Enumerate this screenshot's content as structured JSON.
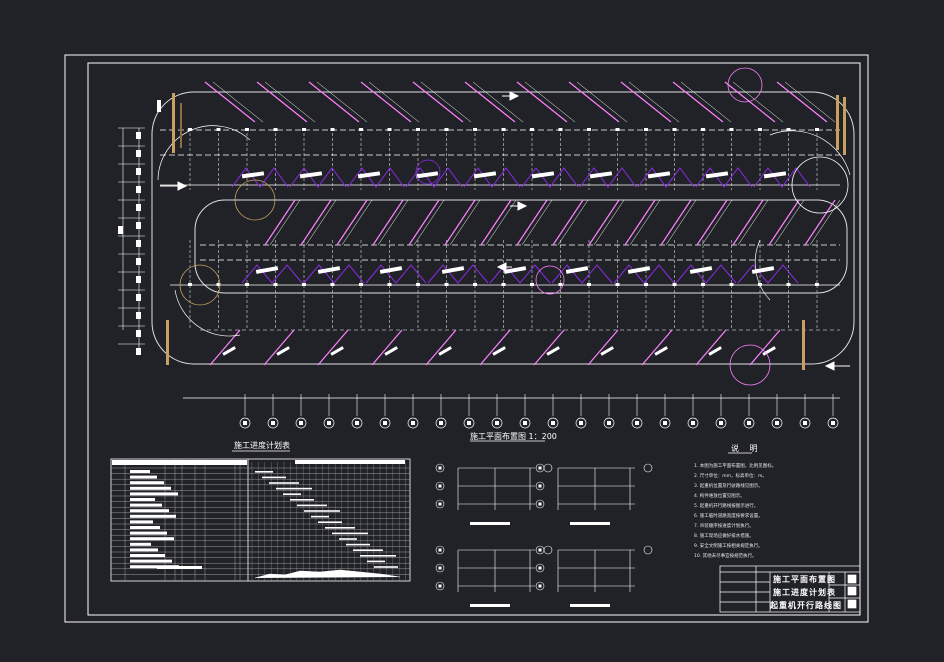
{
  "drawing": {
    "schedule_title": "施工进度计划表",
    "site_plan_title": "施工平面布置图 1：200",
    "notes_title": "说 明",
    "notes": [
      "1. 本图为施工平面布置图，比例见图标。",
      "2. 尺寸单位：mm，标高单位：m。",
      "3. 起重机位置及行驶路线见图示。",
      "4. 构件堆放位置见图示。",
      "5. 起重机开行路线按图示进行。",
      "6. 施工临时道路宽度按要求设置。",
      "7. 吊装顺序按进度计划执行。",
      "8. 施工现场应做好排水措施。",
      "9. 安全文明施工按相关规定执行。",
      "10. 其他未尽事宜按规范执行。"
    ],
    "title_block": {
      "line1": "施工平面布置图",
      "line2": "施工进度计划表",
      "line3": "起重机开行路线图"
    }
  },
  "colors": {
    "background": "#202227",
    "frame": "#ffffff",
    "crane_path": "#ff80ff",
    "member": "#8a2be2",
    "stockpile": "#c8a060"
  }
}
